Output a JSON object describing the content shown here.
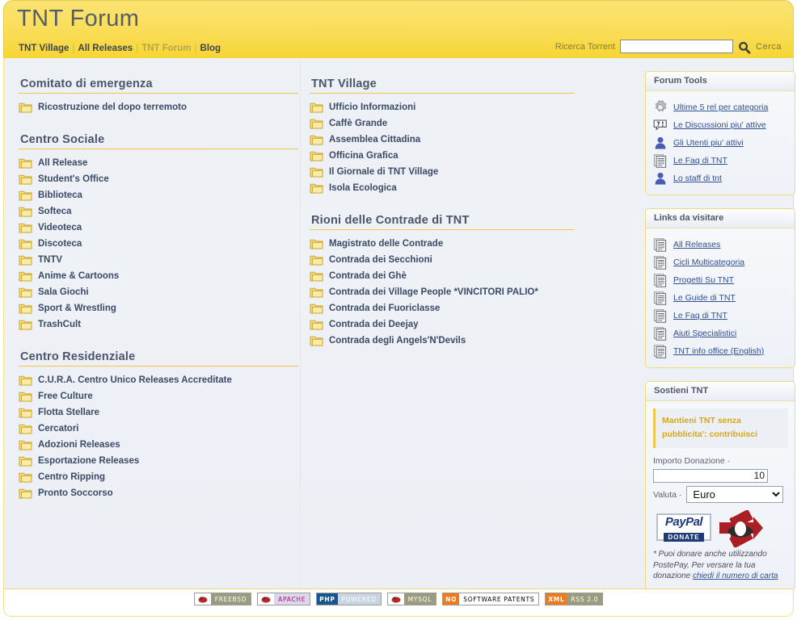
{
  "header": {
    "title": "TNT Forum",
    "nav": [
      {
        "label": "TNT Village",
        "active": false
      },
      {
        "label": "All Releases",
        "active": false
      },
      {
        "label": "TNT Forum",
        "active": true
      },
      {
        "label": "Blog",
        "active": false
      }
    ],
    "search": {
      "label": "Ricerca Torrent",
      "value": "",
      "placeholder": "",
      "button_label": "Cerca",
      "icon": "search-icon"
    },
    "colors": {
      "brand_yellow": "#f9dc52",
      "title_gray": "#555e68"
    }
  },
  "left_column": [
    {
      "title": "Comitato di emergenza",
      "items": [
        "Ricostruzione del dopo terremoto"
      ]
    },
    {
      "title": "Centro Sociale",
      "items": [
        "All Release",
        "Student's Office",
        "Biblioteca",
        "Softeca",
        "Videoteca",
        "Discoteca",
        "TNTV",
        "Anime & Cartoons",
        "Sala Giochi",
        "Sport & Wrestling",
        "TrashCult"
      ]
    },
    {
      "title": "Centro Residenziale",
      "items": [
        "C.U.R.A. Centro Unico Releases Accreditate",
        "Free Culture",
        "Flotta Stellare",
        "Cercatori",
        "Adozioni Releases",
        "Esportazione Releases",
        "Centro Ripping",
        "Pronto Soccorso"
      ]
    }
  ],
  "mid_column": [
    {
      "title": "TNT Village",
      "items": [
        "Ufficio Informazioni",
        "Caffè Grande",
        "Assemblea Cittadina",
        "Officina Grafica",
        "Il Giornale di TNT Village",
        "Isola Ecologica"
      ]
    },
    {
      "title": "Rioni delle Contrade di TNT",
      "items": [
        "Magistrato delle Contrade",
        "Contrada dei Secchioni",
        "Contrada dei Ghè",
        "Contrada dei Village People *VINCITORI PALIO*",
        "Contrada dei Fuoriclasse",
        "Contrada dei Deejay",
        "Contrada degli Angels'N'Devils"
      ]
    }
  ],
  "sidebar": {
    "forum_tools": {
      "title": "Forum Tools",
      "items": [
        {
          "label": "Ultime 5 rel per categoria",
          "icon": "gear-icon"
        },
        {
          "label": "Le Discussioni piu' attive",
          "icon": "speech-bubble-icon"
        },
        {
          "label": "Gli Utenti piu' attivi",
          "icon": "user-icon"
        },
        {
          "label": "Le Faq di TNT",
          "icon": "document-icon"
        },
        {
          "label": "Lo staff di tnt",
          "icon": "user-icon"
        }
      ]
    },
    "links": {
      "title": "Links da visitare",
      "items": [
        {
          "label": "All Releases",
          "icon": "document-icon"
        },
        {
          "label": "Cicli Multicategoria",
          "icon": "document-icon"
        },
        {
          "label": "Progetti Su TNT",
          "icon": "document-icon"
        },
        {
          "label": "Le Guide di TNT",
          "icon": "document-icon"
        },
        {
          "label": "Le Faq di TNT",
          "icon": "document-icon"
        },
        {
          "label": "Aiuti Specialistici",
          "icon": "document-icon"
        },
        {
          "label": "TNT info office (English)",
          "icon": "document-icon"
        }
      ]
    },
    "support": {
      "title": "Sostieni TNT",
      "banner_line1": "Mantieni TNT senza",
      "banner_line2": "pubblicita': contribuisci",
      "amount_label": "Importo Donazione",
      "amount_value": "10",
      "currency_label": "Valuta",
      "currency_value": "Euro",
      "currency_options": [
        "Euro"
      ],
      "paypal_top": "PayPal",
      "paypal_bottom": "DONATE",
      "note_line1": "* Puoi donare anche utilizzando",
      "note_line2": "PostePay, Per versare la tua",
      "note_line3_prefix": "donazione ",
      "note_link": "chiedi il numero di carta"
    }
  },
  "footer": {
    "badges": [
      {
        "left": "",
        "right": "FREEBSD",
        "icon": "freebsd-daemon-icon",
        "left_bg": "#ffffff",
        "right_bg": "#9b9b80",
        "right_fg": "#ffffff"
      },
      {
        "left": "",
        "right": "APACHE",
        "icon": "apache-feather-icon",
        "left_bg": "#ffffff",
        "right_bg": "#d8d8ef",
        "right_fg": "#d0006f"
      },
      {
        "left": "PHP",
        "right": "POWERED",
        "icon": "php-icon",
        "left_bg": "#17568f",
        "right_bg": "#c8d4e2",
        "right_fg": "#ffffff"
      },
      {
        "left": "",
        "right": "MYSQL",
        "icon": "mysql-dolphin-icon",
        "left_bg": "#ffffff",
        "right_bg": "#9b9b80",
        "right_fg": "#ffffff"
      },
      {
        "left": "NO",
        "right": "SOFTWARE PATENTS",
        "icon": "no-icon",
        "left_bg": "#ef7a1a",
        "right_bg": "#ffffff",
        "right_fg": "#000000"
      },
      {
        "left": "XML",
        "right": "RSS 2.0",
        "icon": "xml-icon",
        "left_bg": "#ef7a1a",
        "right_bg": "#9b9b80",
        "right_fg": "#ffffff"
      }
    ]
  }
}
